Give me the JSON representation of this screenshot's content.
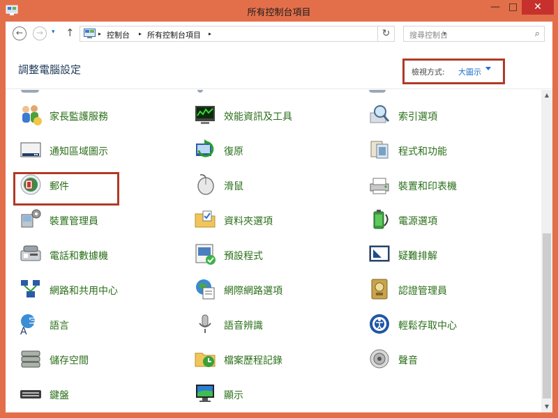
{
  "window": {
    "title": "所有控制台項目",
    "min": "—",
    "max": "□",
    "close": "✕"
  },
  "address": {
    "back": "←",
    "forward": "→",
    "history": "▾",
    "up": "↑",
    "breadcrumb": [
      "控制台",
      "所有控制台項目"
    ],
    "sep": "▸",
    "drop": "▾",
    "refresh": "↻",
    "search_placeholder": "搜尋控制台",
    "search_icon": "⌕"
  },
  "header": {
    "title": "調整電腦設定",
    "view_label": "檢視方式:",
    "view_value": "大圖示"
  },
  "items": [
    {
      "label": "家長監護服務",
      "icon": "family-safety-icon"
    },
    {
      "label": "效能資訊及工具",
      "icon": "performance-icon"
    },
    {
      "label": "索引選項",
      "icon": "indexing-icon"
    },
    {
      "label": "通知區域圖示",
      "icon": "notification-icon"
    },
    {
      "label": "復原",
      "icon": "recovery-icon"
    },
    {
      "label": "程式和功能",
      "icon": "programs-icon"
    },
    {
      "label": "郵件",
      "icon": "mail-icon"
    },
    {
      "label": "滑鼠",
      "icon": "mouse-icon"
    },
    {
      "label": "裝置和印表機",
      "icon": "devices-printers-icon"
    },
    {
      "label": "裝置管理員",
      "icon": "device-manager-icon"
    },
    {
      "label": "資料夾選項",
      "icon": "folder-options-icon"
    },
    {
      "label": "電源選項",
      "icon": "power-icon"
    },
    {
      "label": "電話和數據機",
      "icon": "phone-modem-icon"
    },
    {
      "label": "預設程式",
      "icon": "default-programs-icon"
    },
    {
      "label": "疑難排解",
      "icon": "troubleshooting-icon"
    },
    {
      "label": "網路和共用中心",
      "icon": "network-icon"
    },
    {
      "label": "網際網路選項",
      "icon": "internet-options-icon"
    },
    {
      "label": "認證管理員",
      "icon": "credential-icon"
    },
    {
      "label": "語言",
      "icon": "language-icon"
    },
    {
      "label": "語音辨識",
      "icon": "speech-icon"
    },
    {
      "label": "輕鬆存取中心",
      "icon": "ease-of-access-icon"
    },
    {
      "label": "儲存空間",
      "icon": "storage-spaces-icon"
    },
    {
      "label": "檔案歷程記錄",
      "icon": "file-history-icon"
    },
    {
      "label": "聲音",
      "icon": "sound-icon"
    },
    {
      "label": "鍵盤",
      "icon": "keyboard-icon"
    },
    {
      "label": "顯示",
      "icon": "display-icon"
    }
  ],
  "scrollbar": {
    "up": "▲",
    "down": "▼"
  },
  "colors": {
    "frame": "#e36f4a",
    "close": "#c7312d",
    "link": "#2a6e18",
    "highlight": "#b03a25",
    "title": "#1e395b"
  }
}
